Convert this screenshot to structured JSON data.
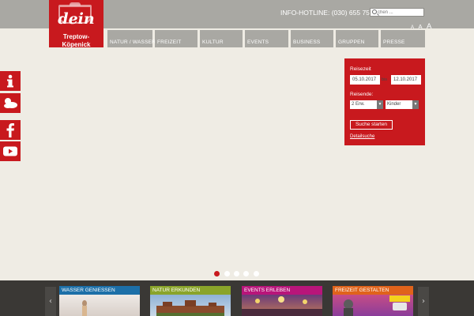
{
  "brand": {
    "logo_word": "dein",
    "logo_place": "Treptow-Köpenick"
  },
  "header": {
    "hotline": "INFO-HOTLINE: (030) 655 75 50",
    "search_placeholder": "chen ...",
    "font_sizes": [
      "A",
      "A",
      "A"
    ]
  },
  "nav": {
    "items": [
      "NATUR / WASSER",
      "FREIZEIT",
      "KULTUR",
      "EVENTS",
      "BUSINESS",
      "GRUPPEN",
      "PRESSE"
    ]
  },
  "side_icons": [
    "info-icon",
    "weather-icon",
    "facebook-icon",
    "youtube-icon"
  ],
  "booking": {
    "reisezeit_label": "Reisezeit",
    "date_from": "05.10.2017",
    "bis_label": "bis",
    "date_to": "12.10.2017",
    "reisende_label": "Reisende:",
    "adults_selected": "2 Erw.",
    "children_selected": "Kinder",
    "search_button": "Suche starten",
    "detail_link": "Detailsuche"
  },
  "slider": {
    "count": 5,
    "active_index": 0
  },
  "teasers": [
    {
      "title": "WASSER GENIESSEN",
      "color": "#1c6fa8"
    },
    {
      "title": "NATUR ERKUNDEN",
      "color": "#8aa42a"
    },
    {
      "title": "EVENTS ERLEBEN",
      "color": "#b8157a"
    },
    {
      "title": "FREIZEIT GESTALTEN",
      "color": "#e0631b"
    }
  ],
  "colors": {
    "brand_red": "#c8191e",
    "gray_bar": "#a9a8a3",
    "background": "#efece4",
    "footer": "#3a3835"
  }
}
